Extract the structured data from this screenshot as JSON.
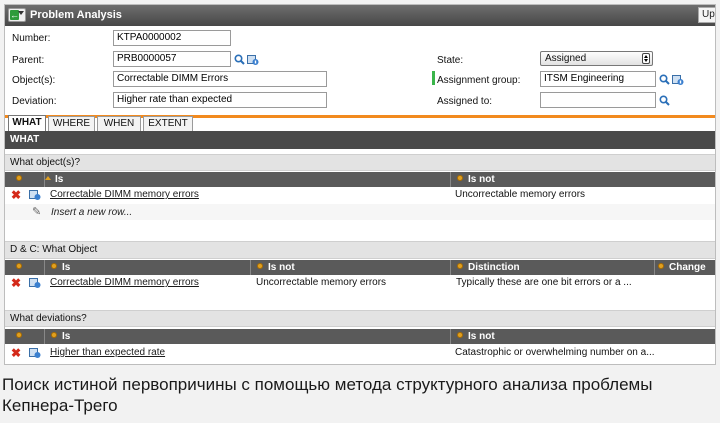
{
  "window": {
    "title": "Problem Analysis",
    "update_button": "Upd"
  },
  "form": {
    "number_label": "Number:",
    "number_value": "KTPA0000002",
    "parent_label": "Parent:",
    "parent_value": "PRB0000057",
    "objects_label": "Object(s):",
    "objects_value": "Correctable DIMM Errors",
    "deviation_label": "Deviation:",
    "deviation_value": "Higher rate than expected",
    "state_label": "State:",
    "state_value": "Assigned",
    "assignment_group_label": "Assignment group:",
    "assignment_group_value": "ITSM Engineering",
    "assigned_to_label": "Assigned to:",
    "assigned_to_value": ""
  },
  "tabs": [
    "WHAT",
    "WHERE",
    "WHEN",
    "EXTENT"
  ],
  "section_title": "WHAT",
  "what_objects": {
    "heading": "What object(s)?",
    "columns": [
      "Is",
      "Is not"
    ],
    "rows": [
      {
        "is": "Correctable DIMM memory errors",
        "is_not": "Uncorrectable memory errors"
      }
    ],
    "insert_label": "Insert a new row..."
  },
  "dc_what_object": {
    "heading": "D & C: What Object",
    "columns": [
      "Is",
      "Is not",
      "Distinction",
      "Change"
    ],
    "rows": [
      {
        "is": "Correctable DIMM memory errors",
        "is_not": "Uncorrectable memory errors",
        "distinction": "Typically these are one bit errors or a ...",
        "change": ""
      }
    ]
  },
  "what_deviations": {
    "heading": "What deviations?",
    "columns": [
      "Is",
      "Is not"
    ],
    "rows": [
      {
        "is": "Higher than expected rate",
        "is_not": "Catastrophic or overwhelming number on a..."
      }
    ]
  },
  "caption": "Поиск истиной первопричины с помощью метода структурного анализа проблемы Кепнера-Трего",
  "colors": {
    "titlebar": "#474747",
    "section_bar": "#4a4a4a",
    "tab_accent": "#f28a1e",
    "delete_icon": "#d42a1a",
    "assignment_marker": "#3ab54a"
  },
  "icons": [
    "back-arrow-icon",
    "search-icon",
    "reference-icon",
    "delete-icon",
    "row-info-icon",
    "pencil-icon",
    "settings-dot-icon",
    "sort-arrow-icon"
  ]
}
